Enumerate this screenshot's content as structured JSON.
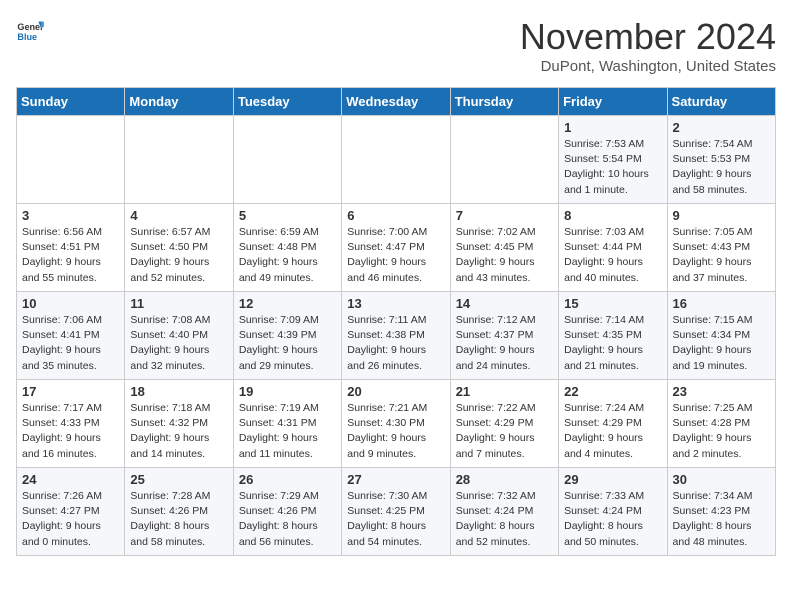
{
  "header": {
    "logo_general": "General",
    "logo_blue": "Blue",
    "month_title": "November 2024",
    "subtitle": "DuPont, Washington, United States"
  },
  "weekdays": [
    "Sunday",
    "Monday",
    "Tuesday",
    "Wednesday",
    "Thursday",
    "Friday",
    "Saturday"
  ],
  "weeks": [
    [
      {
        "day": "",
        "info": ""
      },
      {
        "day": "",
        "info": ""
      },
      {
        "day": "",
        "info": ""
      },
      {
        "day": "",
        "info": ""
      },
      {
        "day": "",
        "info": ""
      },
      {
        "day": "1",
        "info": "Sunrise: 7:53 AM\nSunset: 5:54 PM\nDaylight: 10 hours\nand 1 minute."
      },
      {
        "day": "2",
        "info": "Sunrise: 7:54 AM\nSunset: 5:53 PM\nDaylight: 9 hours\nand 58 minutes."
      }
    ],
    [
      {
        "day": "3",
        "info": "Sunrise: 6:56 AM\nSunset: 4:51 PM\nDaylight: 9 hours\nand 55 minutes."
      },
      {
        "day": "4",
        "info": "Sunrise: 6:57 AM\nSunset: 4:50 PM\nDaylight: 9 hours\nand 52 minutes."
      },
      {
        "day": "5",
        "info": "Sunrise: 6:59 AM\nSunset: 4:48 PM\nDaylight: 9 hours\nand 49 minutes."
      },
      {
        "day": "6",
        "info": "Sunrise: 7:00 AM\nSunset: 4:47 PM\nDaylight: 9 hours\nand 46 minutes."
      },
      {
        "day": "7",
        "info": "Sunrise: 7:02 AM\nSunset: 4:45 PM\nDaylight: 9 hours\nand 43 minutes."
      },
      {
        "day": "8",
        "info": "Sunrise: 7:03 AM\nSunset: 4:44 PM\nDaylight: 9 hours\nand 40 minutes."
      },
      {
        "day": "9",
        "info": "Sunrise: 7:05 AM\nSunset: 4:43 PM\nDaylight: 9 hours\nand 37 minutes."
      }
    ],
    [
      {
        "day": "10",
        "info": "Sunrise: 7:06 AM\nSunset: 4:41 PM\nDaylight: 9 hours\nand 35 minutes."
      },
      {
        "day": "11",
        "info": "Sunrise: 7:08 AM\nSunset: 4:40 PM\nDaylight: 9 hours\nand 32 minutes."
      },
      {
        "day": "12",
        "info": "Sunrise: 7:09 AM\nSunset: 4:39 PM\nDaylight: 9 hours\nand 29 minutes."
      },
      {
        "day": "13",
        "info": "Sunrise: 7:11 AM\nSunset: 4:38 PM\nDaylight: 9 hours\nand 26 minutes."
      },
      {
        "day": "14",
        "info": "Sunrise: 7:12 AM\nSunset: 4:37 PM\nDaylight: 9 hours\nand 24 minutes."
      },
      {
        "day": "15",
        "info": "Sunrise: 7:14 AM\nSunset: 4:35 PM\nDaylight: 9 hours\nand 21 minutes."
      },
      {
        "day": "16",
        "info": "Sunrise: 7:15 AM\nSunset: 4:34 PM\nDaylight: 9 hours\nand 19 minutes."
      }
    ],
    [
      {
        "day": "17",
        "info": "Sunrise: 7:17 AM\nSunset: 4:33 PM\nDaylight: 9 hours\nand 16 minutes."
      },
      {
        "day": "18",
        "info": "Sunrise: 7:18 AM\nSunset: 4:32 PM\nDaylight: 9 hours\nand 14 minutes."
      },
      {
        "day": "19",
        "info": "Sunrise: 7:19 AM\nSunset: 4:31 PM\nDaylight: 9 hours\nand 11 minutes."
      },
      {
        "day": "20",
        "info": "Sunrise: 7:21 AM\nSunset: 4:30 PM\nDaylight: 9 hours\nand 9 minutes."
      },
      {
        "day": "21",
        "info": "Sunrise: 7:22 AM\nSunset: 4:29 PM\nDaylight: 9 hours\nand 7 minutes."
      },
      {
        "day": "22",
        "info": "Sunrise: 7:24 AM\nSunset: 4:29 PM\nDaylight: 9 hours\nand 4 minutes."
      },
      {
        "day": "23",
        "info": "Sunrise: 7:25 AM\nSunset: 4:28 PM\nDaylight: 9 hours\nand 2 minutes."
      }
    ],
    [
      {
        "day": "24",
        "info": "Sunrise: 7:26 AM\nSunset: 4:27 PM\nDaylight: 9 hours\nand 0 minutes."
      },
      {
        "day": "25",
        "info": "Sunrise: 7:28 AM\nSunset: 4:26 PM\nDaylight: 8 hours\nand 58 minutes."
      },
      {
        "day": "26",
        "info": "Sunrise: 7:29 AM\nSunset: 4:26 PM\nDaylight: 8 hours\nand 56 minutes."
      },
      {
        "day": "27",
        "info": "Sunrise: 7:30 AM\nSunset: 4:25 PM\nDaylight: 8 hours\nand 54 minutes."
      },
      {
        "day": "28",
        "info": "Sunrise: 7:32 AM\nSunset: 4:24 PM\nDaylight: 8 hours\nand 52 minutes."
      },
      {
        "day": "29",
        "info": "Sunrise: 7:33 AM\nSunset: 4:24 PM\nDaylight: 8 hours\nand 50 minutes."
      },
      {
        "day": "30",
        "info": "Sunrise: 7:34 AM\nSunset: 4:23 PM\nDaylight: 8 hours\nand 48 minutes."
      }
    ]
  ]
}
